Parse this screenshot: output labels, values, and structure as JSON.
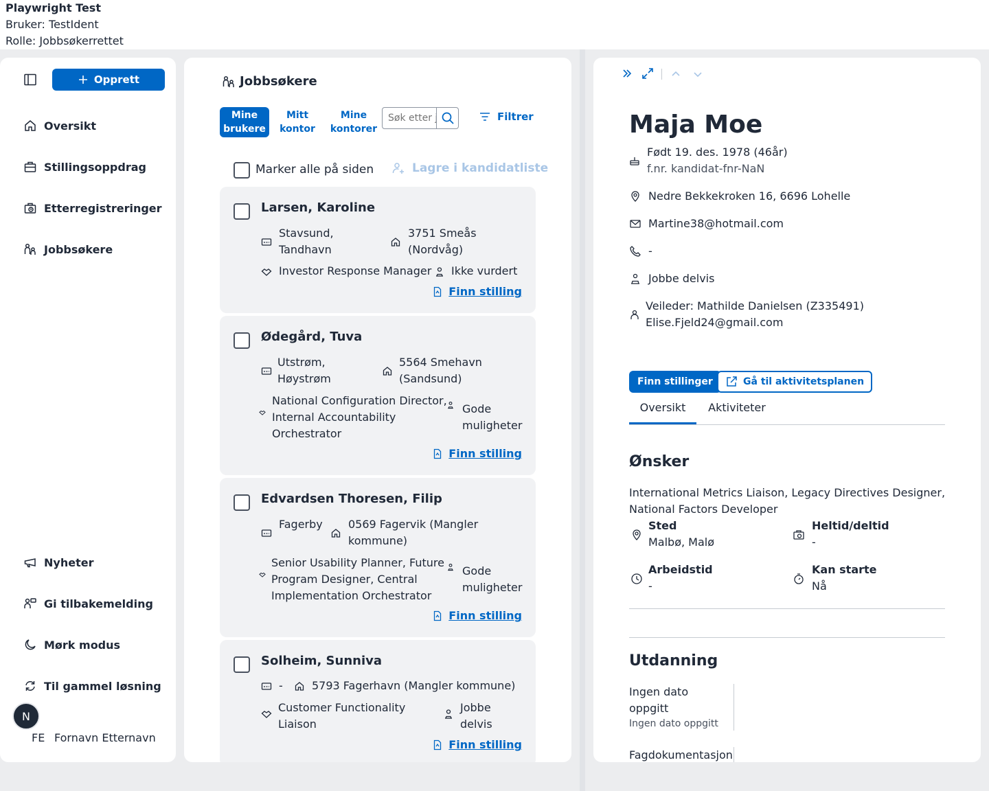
{
  "top": {
    "title": "Playwright Test",
    "user": "Bruker: TestIdent",
    "role": "Rolle: Jobbsøkerrettet"
  },
  "sidebar": {
    "create_label": "Opprett",
    "nav": [
      {
        "label": "Oversikt",
        "icon": "house-icon"
      },
      {
        "label": "Stillingsoppdrag",
        "icon": "briefcase-icon"
      },
      {
        "label": "Etterregistreringer",
        "icon": "briefcase-clock-icon"
      },
      {
        "label": "Jobbsøkere",
        "icon": "persons-icon"
      }
    ],
    "bottom": [
      {
        "label": "Nyheter",
        "icon": "megaphone-icon"
      },
      {
        "label": "Gi tilbakemelding",
        "icon": "feedback-icon"
      },
      {
        "label": "Mørk modus",
        "icon": "moon-icon"
      },
      {
        "label": "Til gammel løsning",
        "icon": "arrows-circle-icon"
      }
    ],
    "avatar_letter": "N",
    "user_initials": "FE",
    "user_name": "Fornavn Etternavn"
  },
  "list": {
    "title": "Jobbsøkere",
    "tabs": [
      {
        "line1": "Mine",
        "line2": "brukere"
      },
      {
        "line1": "Mitt",
        "line2": "kontor"
      },
      {
        "line1": "Mine",
        "line2": "kontorer"
      }
    ],
    "search_placeholder": "Søk etter jobbsøker",
    "filter_label": "Filtrer",
    "select_all_label": "Marker alle på siden",
    "save_list_label": "Lagre i kandidatliste",
    "find_job_label": "Finn stilling",
    "candidates": [
      {
        "name": "Larsen, Karoline",
        "location_1": "Stavsund,",
        "location_2": "Tandhavn",
        "address_1": "3751 Smeås",
        "address_2": "(Nordvåg)",
        "wish_1": "Investor Response Manager",
        "wish_2": "",
        "wish_3": "",
        "status_1": "Ikke vurdert",
        "status_2": ""
      },
      {
        "name": "Ødegård, Tuva",
        "location_1": "Utstrøm,",
        "location_2": "Høystrøm",
        "address_1": "5564 Smehavn",
        "address_2": "(Sandsund)",
        "wish_1": "National Configuration Director,",
        "wish_2": "Internal Accountability",
        "wish_3": "Orchestrator",
        "status_1": "Gode",
        "status_2": "muligheter"
      },
      {
        "name": "Edvardsen Thoresen, Filip",
        "location_1": "Fagerby",
        "location_2": "",
        "address_1": "0569 Fagervik (Mangler",
        "address_2": "kommune)",
        "wish_1": "Senior Usability Planner, Future",
        "wish_2": "Program Designer, Central",
        "wish_3": "Implementation Orchestrator",
        "status_1": "Gode",
        "status_2": "muligheter"
      },
      {
        "name": "Solheim, Sunniva",
        "location_1": "-",
        "location_2": "",
        "address_1": "5793 Fagerhavn (Mangler kommune)",
        "address_2": "",
        "wish_1": "Customer Functionality",
        "wish_2": "Liaison",
        "wish_3": "",
        "status_1": "Jobbe",
        "status_2": "delvis"
      }
    ]
  },
  "detail": {
    "name": "Maja Moe",
    "born": "Født 19. des. 1978 (46år)",
    "fnr": "f.nr. kandidat-fnr-NaN",
    "address": "Nedre Bekkekroken 16, 6696 Lohelle",
    "email": "Martine38@hotmail.com",
    "phone": "-",
    "status": "Jobbe delvis",
    "veileder": "Veileder: Mathilde Danielsen (Z335491)",
    "veileder_email": "Elise.Fjeld24@gmail.com",
    "btn_find": "Finn stillinger",
    "btn_plan": "Gå til aktivitetsplanen",
    "tabs": [
      "Oversikt",
      "Aktiviteter"
    ],
    "wishes_heading": "Ønsker",
    "wishes_text_1": "International Metrics Liaison, Legacy Directives Designer,",
    "wishes_text_2": "National Factors Developer",
    "place_label": "Sted",
    "place_value": "Malbø, Malø",
    "fulltime_label": "Heltid/deltid",
    "fulltime_value": "-",
    "worktime_label": "Arbeidstid",
    "worktime_value": "-",
    "start_label": "Kan starte",
    "start_value": "Nå",
    "education_heading": "Utdanning",
    "edu_date_1": "Ingen dato",
    "edu_date_2": "oppgitt",
    "edu_sub": "Ingen dato oppgitt",
    "edu_next": "Fagdokumentasjon"
  },
  "colors": {
    "accent": "#0067c5",
    "card_bg": "#f1f2f4",
    "page_bg": "#ecedef"
  }
}
